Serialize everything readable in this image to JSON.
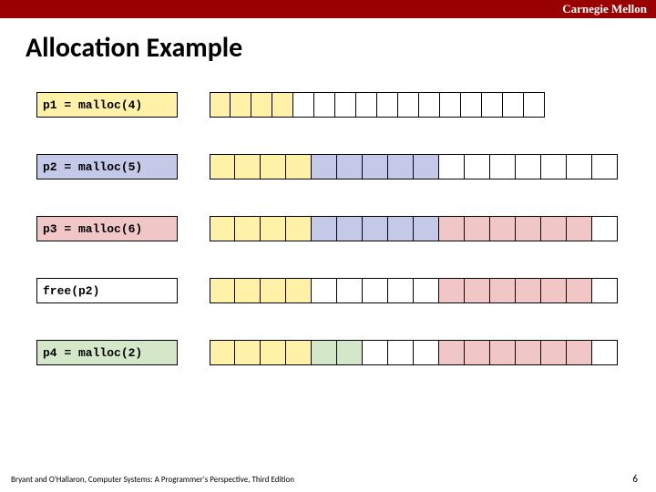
{
  "header": {
    "org": "Carnegie Mellon"
  },
  "title": "Allocation Example",
  "colors": {
    "yellow": "#fff2a8",
    "blue": "#c5c9e8",
    "pink": "#f0c6c6",
    "green": "#d4e8c9",
    "white": "#ffffff"
  },
  "cell_width_narrow": 23,
  "cell_width_wide": 28,
  "rows": [
    {
      "code": "p1 = malloc(4)",
      "codebg": "yellow",
      "cells": [
        {
          "c": "yellow",
          "n": 4
        },
        {
          "c": "white",
          "n": 12
        }
      ],
      "wide": false
    },
    {
      "code": "p2 = malloc(5)",
      "codebg": "blue",
      "cells": [
        {
          "c": "yellow",
          "n": 4
        },
        {
          "c": "blue",
          "n": 5
        },
        {
          "c": "white",
          "n": 7
        }
      ],
      "wide": true
    },
    {
      "code": "p3 = malloc(6)",
      "codebg": "pink",
      "cells": [
        {
          "c": "yellow",
          "n": 4
        },
        {
          "c": "blue",
          "n": 5
        },
        {
          "c": "pink",
          "n": 6
        },
        {
          "c": "white",
          "n": 1
        }
      ],
      "wide": true
    },
    {
      "code": "free(p2)",
      "codebg": "white",
      "cells": [
        {
          "c": "yellow",
          "n": 4
        },
        {
          "c": "white",
          "n": 5
        },
        {
          "c": "pink",
          "n": 6
        },
        {
          "c": "white",
          "n": 1
        }
      ],
      "wide": true
    },
    {
      "code": "p4 = malloc(2)",
      "codebg": "green",
      "cells": [
        {
          "c": "yellow",
          "n": 4
        },
        {
          "c": "green",
          "n": 2
        },
        {
          "c": "white",
          "n": 3
        },
        {
          "c": "pink",
          "n": 6
        },
        {
          "c": "white",
          "n": 1
        }
      ],
      "wide": true
    }
  ],
  "footer": "Bryant and O'Hallaron, Computer Systems: A Programmer's Perspective, Third Edition",
  "page": "6"
}
